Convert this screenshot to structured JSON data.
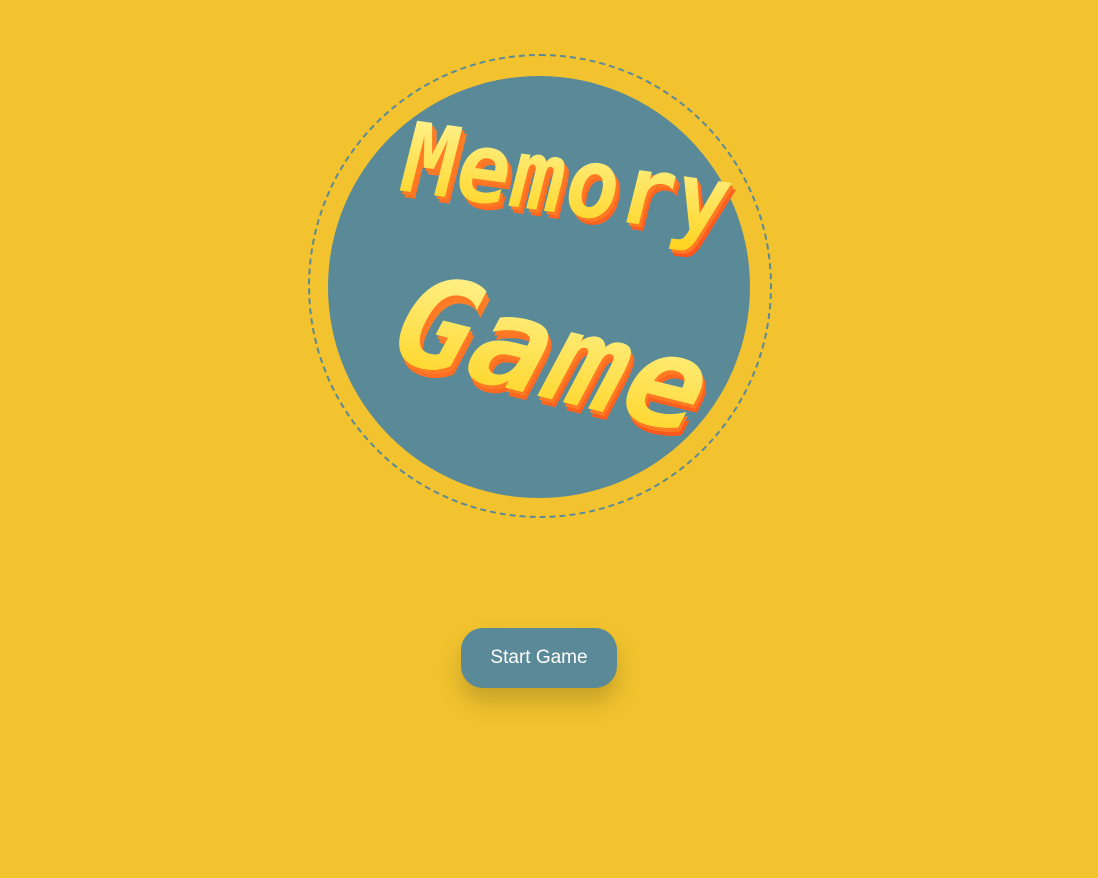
{
  "logo": {
    "line1": "Memory",
    "line2": "Game",
    "colors": {
      "disc": "#5a8a98",
      "ring": "#5a8a98",
      "letter_face_top": "#fff59a",
      "letter_face_bottom": "#ffd21a",
      "letter_side": "#ff5a1f"
    }
  },
  "start_button": {
    "label": "Start Game"
  },
  "colors": {
    "background": "#f2c32e",
    "button": "#5a8a98",
    "button_text": "#ffffff"
  }
}
